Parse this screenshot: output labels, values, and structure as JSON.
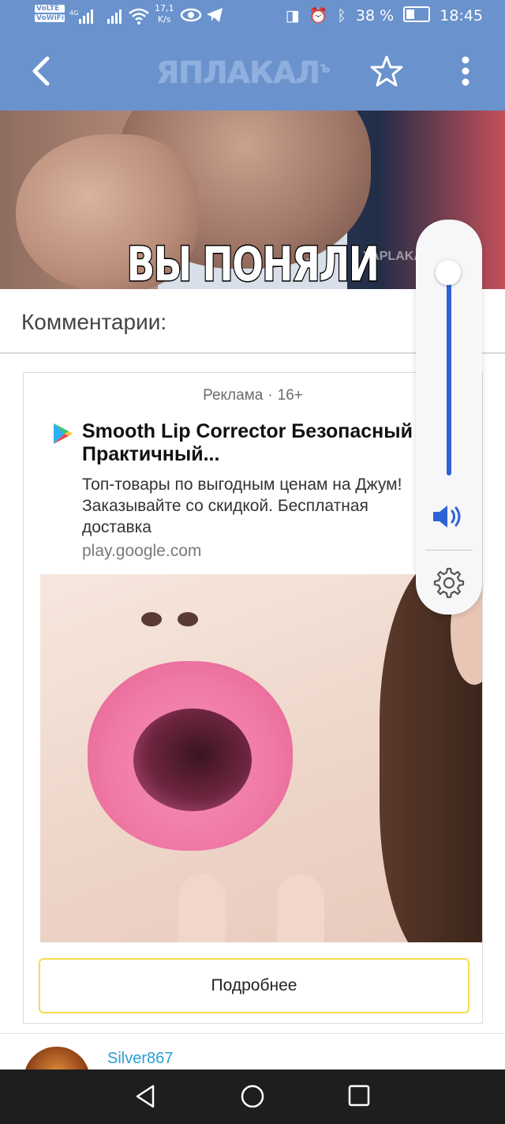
{
  "status_bar": {
    "net_labels": [
      "VoLTE",
      "VoWiFi"
    ],
    "signal_label": "4G",
    "speed_value": "17,1",
    "speed_unit": "K/s",
    "battery": "38 %",
    "time": "18:45"
  },
  "app_bar": {
    "logo": "ЯПЛАКАЛ",
    "logo_suffix": "ъ"
  },
  "meme": {
    "caption": "ВЫ ПОНЯЛИ",
    "watermark": "YAPLAKAL"
  },
  "comments": {
    "heading": "Комментарии:"
  },
  "ad": {
    "label": "Реклама",
    "separator": "·",
    "age": "16+",
    "title": "Smooth Lip Corrector Безопасный\nПрактичный...",
    "description": "Топ-товары по выгодным ценам на Джум!\nЗаказывайте со скидкой. Бесплатная\nдоставка",
    "domain": "play.google.com",
    "cta": "Подробнее"
  },
  "first_comment": {
    "username": "Silver867"
  },
  "colors": {
    "app_bar": "#6a92cc",
    "volume_fill": "#2d63d8",
    "cta_border": "#f1dd4f",
    "username": "#2a9fd6"
  }
}
